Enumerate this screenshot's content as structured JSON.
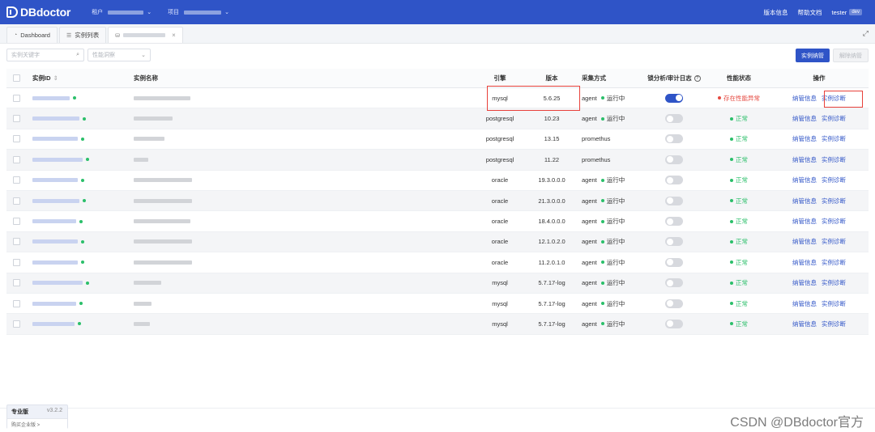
{
  "brand": {
    "name": "DBdoctor"
  },
  "topbar": {
    "tenant_label": "租户",
    "project_label": "项目",
    "version_info": "版本信息",
    "help_docs": "帮助文档",
    "user": "tester",
    "user_badge": "dev"
  },
  "tabs": [
    {
      "label": "Dashboard"
    },
    {
      "label": "实例列表"
    },
    {
      "label": ""
    }
  ],
  "filters": {
    "search_placeholder": "实例关键字",
    "perf_placeholder": "性能洞察"
  },
  "actions": {
    "onboard": "实例纳管",
    "offboard": "解除纳管"
  },
  "table": {
    "headers": {
      "id": "实例ID",
      "name": "实例名称",
      "engine": "引擎",
      "version": "版本",
      "collect": "采集方式",
      "lock": "锁分析/审计日志",
      "perf": "性能状态",
      "ops": "操作"
    },
    "rows": [
      {
        "engine": "mysql",
        "version": "5.6.25",
        "collect": "agent",
        "run_status": "运行中",
        "lock_on": true,
        "perf": "存在性能异常",
        "perf_ok": false
      },
      {
        "engine": "postgresql",
        "version": "10.23",
        "collect": "agent",
        "run_status": "运行中",
        "lock_on": false,
        "perf": "正常",
        "perf_ok": true
      },
      {
        "engine": "postgresql",
        "version": "13.15",
        "collect": "promethus",
        "run_status": "",
        "lock_on": false,
        "perf": "正常",
        "perf_ok": true
      },
      {
        "engine": "postgresql",
        "version": "11.22",
        "collect": "promethus",
        "run_status": "",
        "lock_on": false,
        "perf": "正常",
        "perf_ok": true
      },
      {
        "engine": "oracle",
        "version": "19.3.0.0.0",
        "collect": "agent",
        "run_status": "运行中",
        "lock_on": false,
        "perf": "正常",
        "perf_ok": true
      },
      {
        "engine": "oracle",
        "version": "21.3.0.0.0",
        "collect": "agent",
        "run_status": "运行中",
        "lock_on": false,
        "perf": "正常",
        "perf_ok": true
      },
      {
        "engine": "oracle",
        "version": "18.4.0.0.0",
        "collect": "agent",
        "run_status": "运行中",
        "lock_on": false,
        "perf": "正常",
        "perf_ok": true
      },
      {
        "engine": "oracle",
        "version": "12.1.0.2.0",
        "collect": "agent",
        "run_status": "运行中",
        "lock_on": false,
        "perf": "正常",
        "perf_ok": true
      },
      {
        "engine": "oracle",
        "version": "11.2.0.1.0",
        "collect": "agent",
        "run_status": "运行中",
        "lock_on": false,
        "perf": "正常",
        "perf_ok": true
      },
      {
        "engine": "mysql",
        "version": "5.7.17-log",
        "collect": "agent",
        "run_status": "运行中",
        "lock_on": false,
        "perf": "正常",
        "perf_ok": true
      },
      {
        "engine": "mysql",
        "version": "5.7.17-log",
        "collect": "agent",
        "run_status": "运行中",
        "lock_on": false,
        "perf": "正常",
        "perf_ok": true
      },
      {
        "engine": "mysql",
        "version": "5.7.17-log",
        "collect": "agent",
        "run_status": "运行中",
        "lock_on": false,
        "perf": "正常",
        "perf_ok": true
      }
    ],
    "op_manage": "纳管信息",
    "op_diagnose": "实例诊断"
  },
  "edition": {
    "name": "专业版",
    "version": "v3.2.2",
    "upgrade": "购买企业版 >"
  },
  "watermark": "CSDN @DBdoctor官方",
  "colors": {
    "primary": "#2f54c7",
    "success": "#2bbf6a",
    "danger": "#e5483f"
  }
}
